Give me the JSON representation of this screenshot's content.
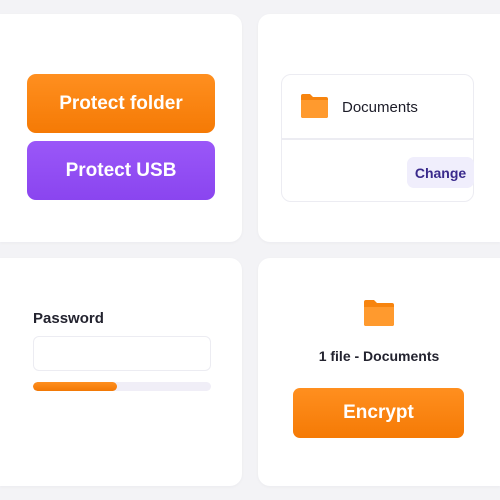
{
  "actions": {
    "protect_folder_label": "Protect folder",
    "protect_usb_label": "Protect USB"
  },
  "folder_selector": {
    "folder_name": "Documents",
    "change_label": "Change",
    "icon": "folder-icon"
  },
  "password": {
    "label": "Password",
    "value": "",
    "strength_fraction": 0.47
  },
  "encrypt": {
    "summary": "1 file - Documents",
    "button_label": "Encrypt",
    "icon": "folder-icon"
  },
  "colors": {
    "accent_orange": "#f57a05",
    "accent_purple": "#8a45ef",
    "change_button_bg": "#f0eefc",
    "background": "#f3f3f6"
  }
}
